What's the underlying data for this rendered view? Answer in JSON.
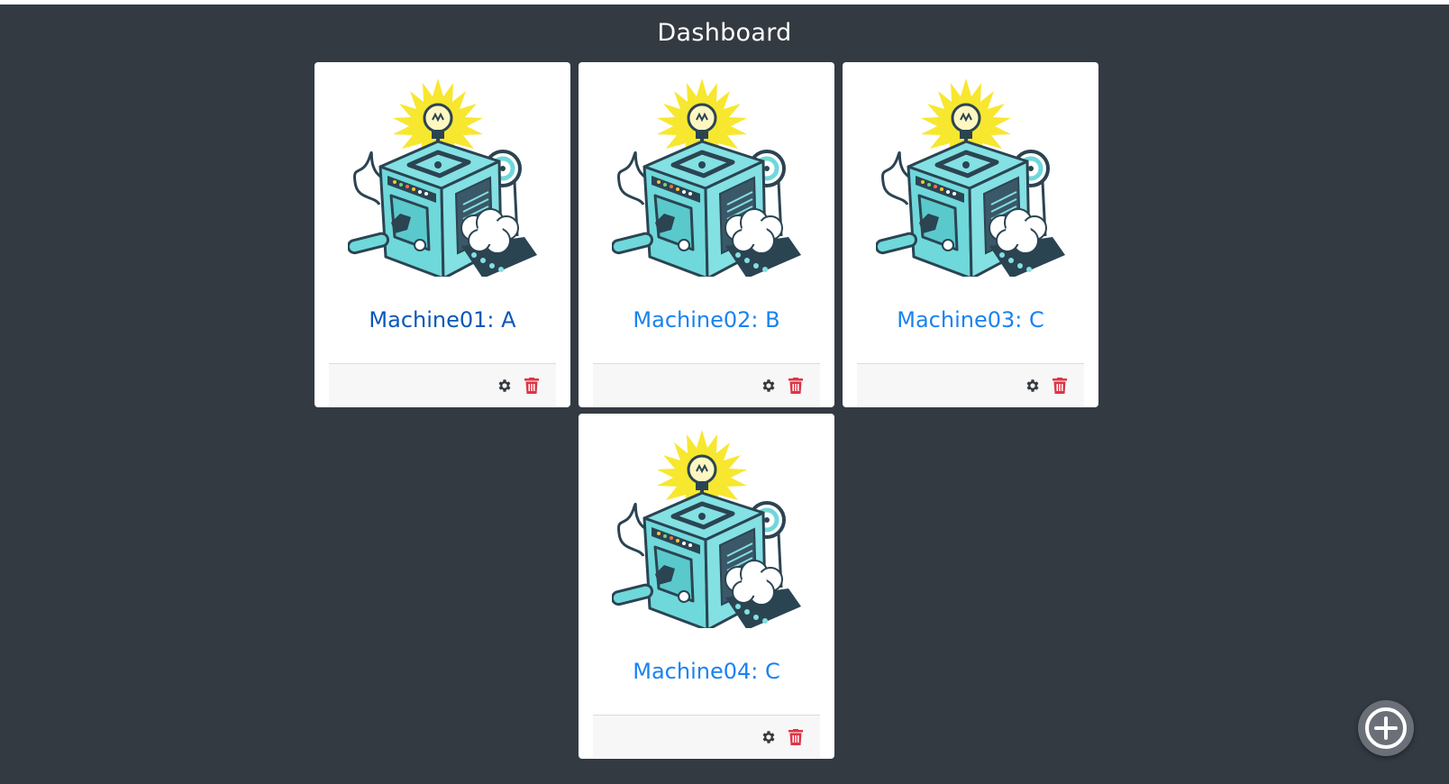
{
  "header": {
    "title": "Dashboard"
  },
  "colors": {
    "page_background": "#343a42",
    "card_background": "#ffffff",
    "link": "#1a82f0",
    "link_active": "#0a57b8",
    "delete": "#dc3545",
    "settings": "#343a40",
    "fab": "#6b7078"
  },
  "machines": [
    {
      "name": "Machine01: A",
      "image": "machine-illustration",
      "actions": [
        "gear-icon",
        "trash-icon"
      ]
    },
    {
      "name": "Machine02: B",
      "image": "machine-illustration",
      "actions": [
        "gear-icon",
        "trash-icon"
      ]
    },
    {
      "name": "Machine03: C",
      "image": "machine-illustration",
      "actions": [
        "gear-icon",
        "trash-icon"
      ]
    },
    {
      "name": "Machine04: C",
      "image": "machine-illustration",
      "actions": [
        "gear-icon",
        "trash-icon"
      ]
    }
  ],
  "fab": {
    "icon": "plus-circle-icon"
  }
}
